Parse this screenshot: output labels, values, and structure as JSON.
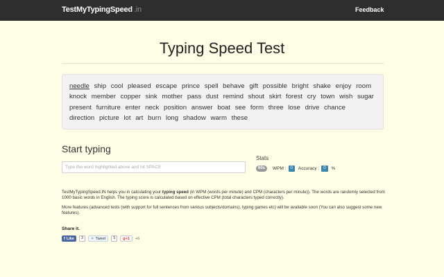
{
  "navbar": {
    "brand": "TestMyTypingSpeed",
    "brand_tld": ".in",
    "feedback": "Feedback"
  },
  "page_title": "Typing Speed Test",
  "words": [
    "needle",
    "ship",
    "cool",
    "pleased",
    "escape",
    "prince",
    "spell",
    "behave",
    "gift",
    "possible",
    "bright",
    "shake",
    "enjoy",
    "room",
    "knock",
    "member",
    "copper",
    "sink",
    "mother",
    "pass",
    "dust",
    "remind",
    "shout",
    "skirt",
    "forest",
    "cry",
    "town",
    "wish",
    "sugar",
    "present",
    "furniture",
    "enter",
    "neck",
    "position",
    "answer",
    "boat",
    "see",
    "form",
    "three",
    "lose",
    "drive",
    "chance",
    "direction",
    "picture",
    "lot",
    "art",
    "burn",
    "long",
    "shadow",
    "warm",
    "these"
  ],
  "start_heading": "Start typing",
  "input": {
    "placeholder": "Type the word highlighted above and hit SPACE",
    "value": ""
  },
  "stats": {
    "label": "Stats",
    "timer": "60s",
    "wpm_label": "WPM :",
    "wpm_value": "0",
    "accuracy_label": "Accuracy :",
    "accuracy_value": "0",
    "accuracy_unit": "%"
  },
  "description": {
    "p1_pre": "TestMyTypingSpeed.IN helps you in calculating your ",
    "p1_bold": "typing speed",
    "p1_post": " (in WPM (words per minute) and CPM (characters per minute)). The words are randomly selected from 1000 basic words in English. The typing score is calculated based on effective CPM (total characters typed correctly).",
    "p2": "More features (advanced tests (with support for full sentences from various subjects/domains), typing games etc) will be available soon (You can also suggest some new features)."
  },
  "share": {
    "title": "Share it.",
    "facebook_label": "Like",
    "facebook_count": "3",
    "twitter_label": "Tweet",
    "twitter_count": "5",
    "gplus_label": "g+1",
    "gplus_count": "+6"
  }
}
